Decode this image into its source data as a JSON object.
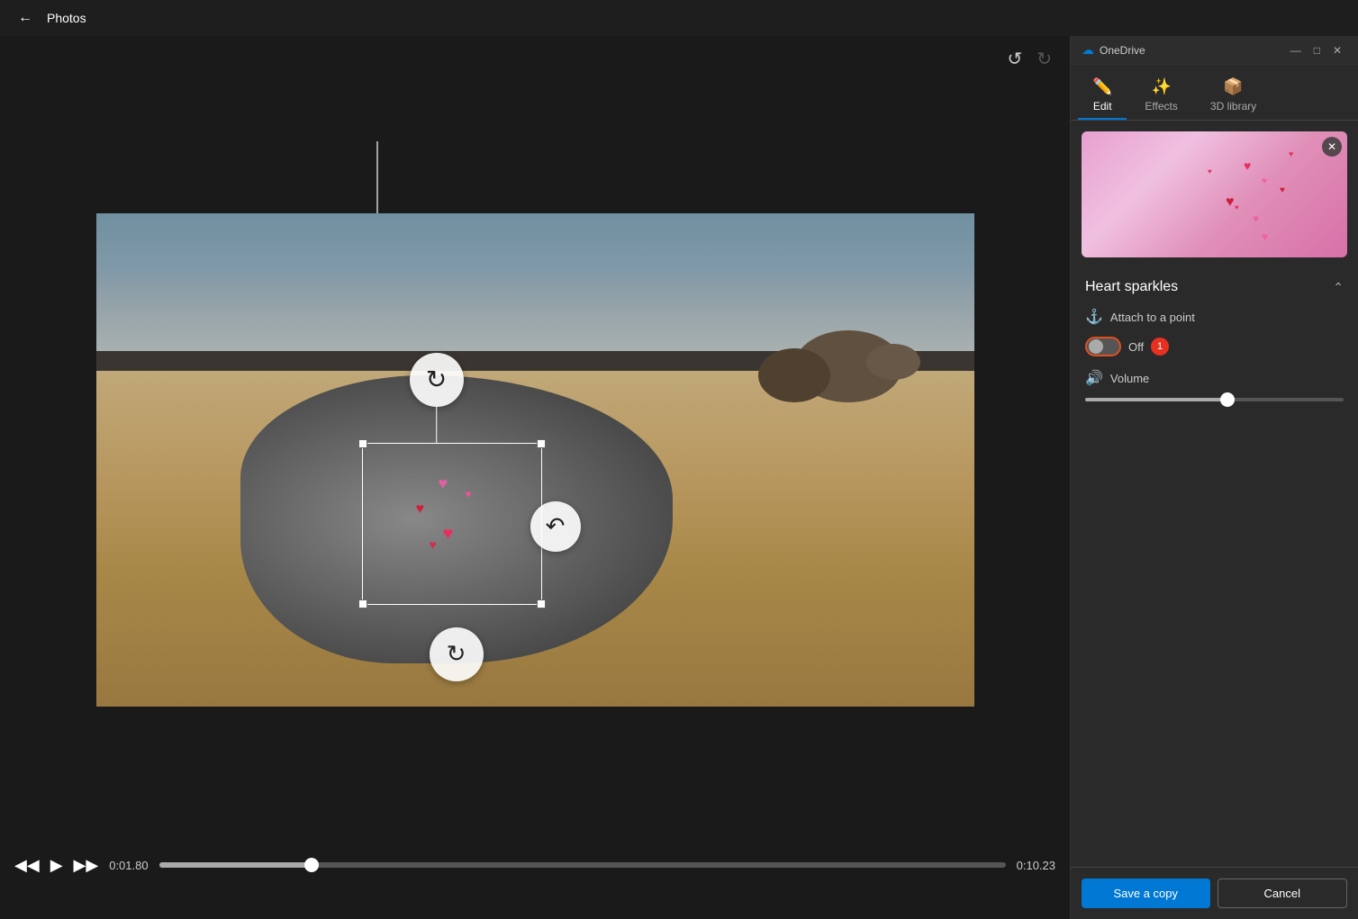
{
  "app": {
    "title": "Photos",
    "back_label": "←"
  },
  "titlebar": {
    "onedrive_label": "OneDrive",
    "minimize": "—",
    "maximize": "□",
    "close": "✕"
  },
  "tabs": [
    {
      "id": "edit",
      "label": "Edit",
      "icon": "✏️",
      "active": true
    },
    {
      "id": "effects",
      "label": "Effects",
      "icon": "✨",
      "active": false
    },
    {
      "id": "3d_library",
      "label": "3D library",
      "icon": "📦",
      "active": false
    }
  ],
  "toolbar": {
    "undo_label": "↺",
    "redo_label": "↻"
  },
  "effect": {
    "name": "Heart sparkles",
    "attach_label": "Attach to a point",
    "toggle_state": "Off",
    "toggle_badge": "1",
    "volume_label": "Volume",
    "volume_value": 55
  },
  "playback": {
    "current_time": "0:01.80",
    "end_time": "0:10.23",
    "progress_percent": 18
  },
  "buttons": {
    "save_copy": "Save a copy",
    "cancel": "Cancel"
  }
}
